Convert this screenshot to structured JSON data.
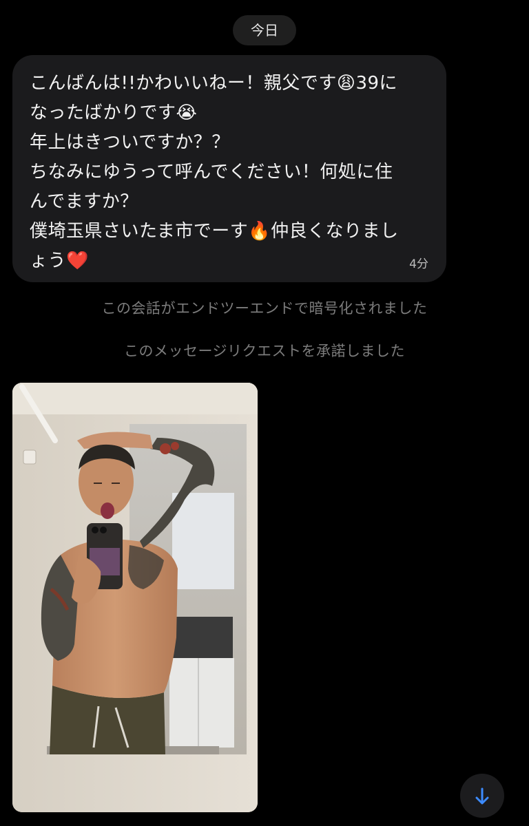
{
  "date_label": "今日",
  "message": {
    "lines": [
      "こんばんは!!かわいいねー！親父です😩39に",
      "なったばかりです😭",
      "年上はきついですか？？",
      "ちなみにゆうって呼んでください！何処に住",
      "んでますか？",
      "僕埼玉県さいたま市でーす🔥仲良くなりまし",
      "ょう❤️"
    ],
    "time": "4分"
  },
  "system_notes": {
    "encrypted": "この会話がエンドツーエンドで暗号化されました",
    "accepted": "このメッセージリクエストを承諾しました"
  },
  "icons": {
    "scroll_down": "arrow-down-icon"
  },
  "colors": {
    "background": "#000000",
    "bubble": "#1b1b1d",
    "system_text": "#7c7c7c",
    "accent": "#3d8bfd"
  }
}
